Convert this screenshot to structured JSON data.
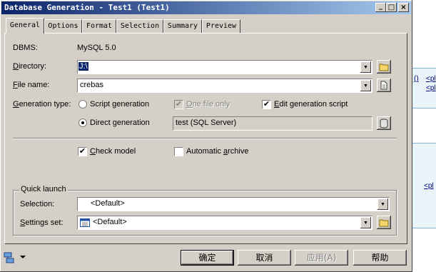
{
  "window": {
    "title": "Database Generation - Test1 (Test1)",
    "controls": {
      "minimize": "_",
      "maximize": "□",
      "close": "×"
    }
  },
  "tabs": [
    "General",
    "Options",
    "Format",
    "Selection",
    "Summary",
    "Preview"
  ],
  "active_tab": "General",
  "general": {
    "dbms_label": "DBMS:",
    "dbms_value": "MySQL 5.0",
    "directory_label": "Directory:",
    "directory_value": "J:\\",
    "filename_label": "File name:",
    "filename_value": "crebas",
    "gentype_label": "Generation type:",
    "script_generation": "Script generation",
    "direct_generation": "Direct generation",
    "one_file_only": "One file only",
    "edit_generation_script": "Edit generation script",
    "datasource_value": "test (SQL Server)",
    "check_model": "Check model",
    "automatic_archive": "Automatic archive"
  },
  "state": {
    "generation_type": "direct",
    "one_file_only_checked": true,
    "edit_generation_script_checked": true,
    "check_model_checked": true,
    "automatic_archive_checked": false
  },
  "quick_launch": {
    "group_label": "Quick launch",
    "selection_label": "Selection:",
    "selection_value": "<Default>",
    "settings_label": "Settings set:",
    "settings_value": "<Default>"
  },
  "buttons": {
    "ok": "确定",
    "cancel": "取消",
    "apply": "应用(A)",
    "help": "帮助"
  },
  "background": {
    "fragments": [
      "()",
      "<pl",
      "<pl",
      "<pl"
    ]
  },
  "colors": {
    "face": "#d4d0c8",
    "title_start": "#0a246a",
    "title_end": "#a6caf0",
    "selection": "#0a246a",
    "bg_panel": "#e8f4f8"
  }
}
